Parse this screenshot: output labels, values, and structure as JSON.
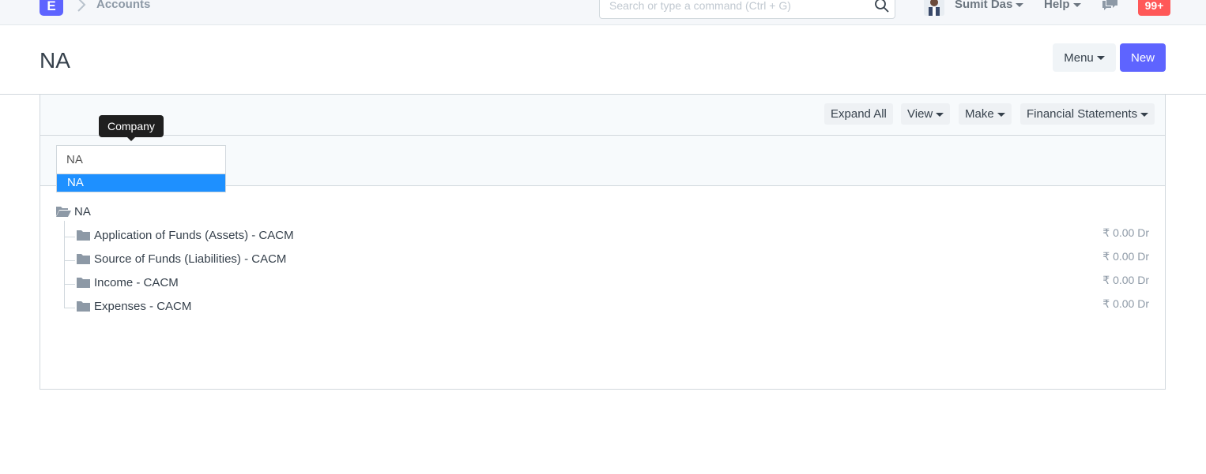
{
  "navbar": {
    "logo": "E",
    "breadcrumb": "Accounts",
    "search_placeholder": "Search or type a command (Ctrl + G)",
    "user_name": "Sumit Das",
    "help_label": "Help",
    "notification_count": "99+"
  },
  "page": {
    "title": "NA",
    "menu_label": "Menu",
    "new_label": "New"
  },
  "toolbar": {
    "expand_all": "Expand All",
    "view": "View",
    "make": "Make",
    "financial_statements": "Financial Statements"
  },
  "filter": {
    "tooltip": "Company",
    "company_value": "NA",
    "suggestion": "NA"
  },
  "tree": {
    "root": "NA",
    "nodes": [
      {
        "label": "Application of Funds (Assets) - CACM",
        "balance": "₹ 0.00 Dr"
      },
      {
        "label": "Source of Funds (Liabilities) - CACM",
        "balance": "₹ 0.00 Dr"
      },
      {
        "label": "Income - CACM",
        "balance": "₹ 0.00 Dr"
      },
      {
        "label": "Expenses - CACM",
        "balance": "₹ 0.00 Dr"
      }
    ]
  },
  "colors": {
    "brand": "#5e64ff",
    "notification": "#ff5858",
    "selection": "#1e90ff"
  }
}
